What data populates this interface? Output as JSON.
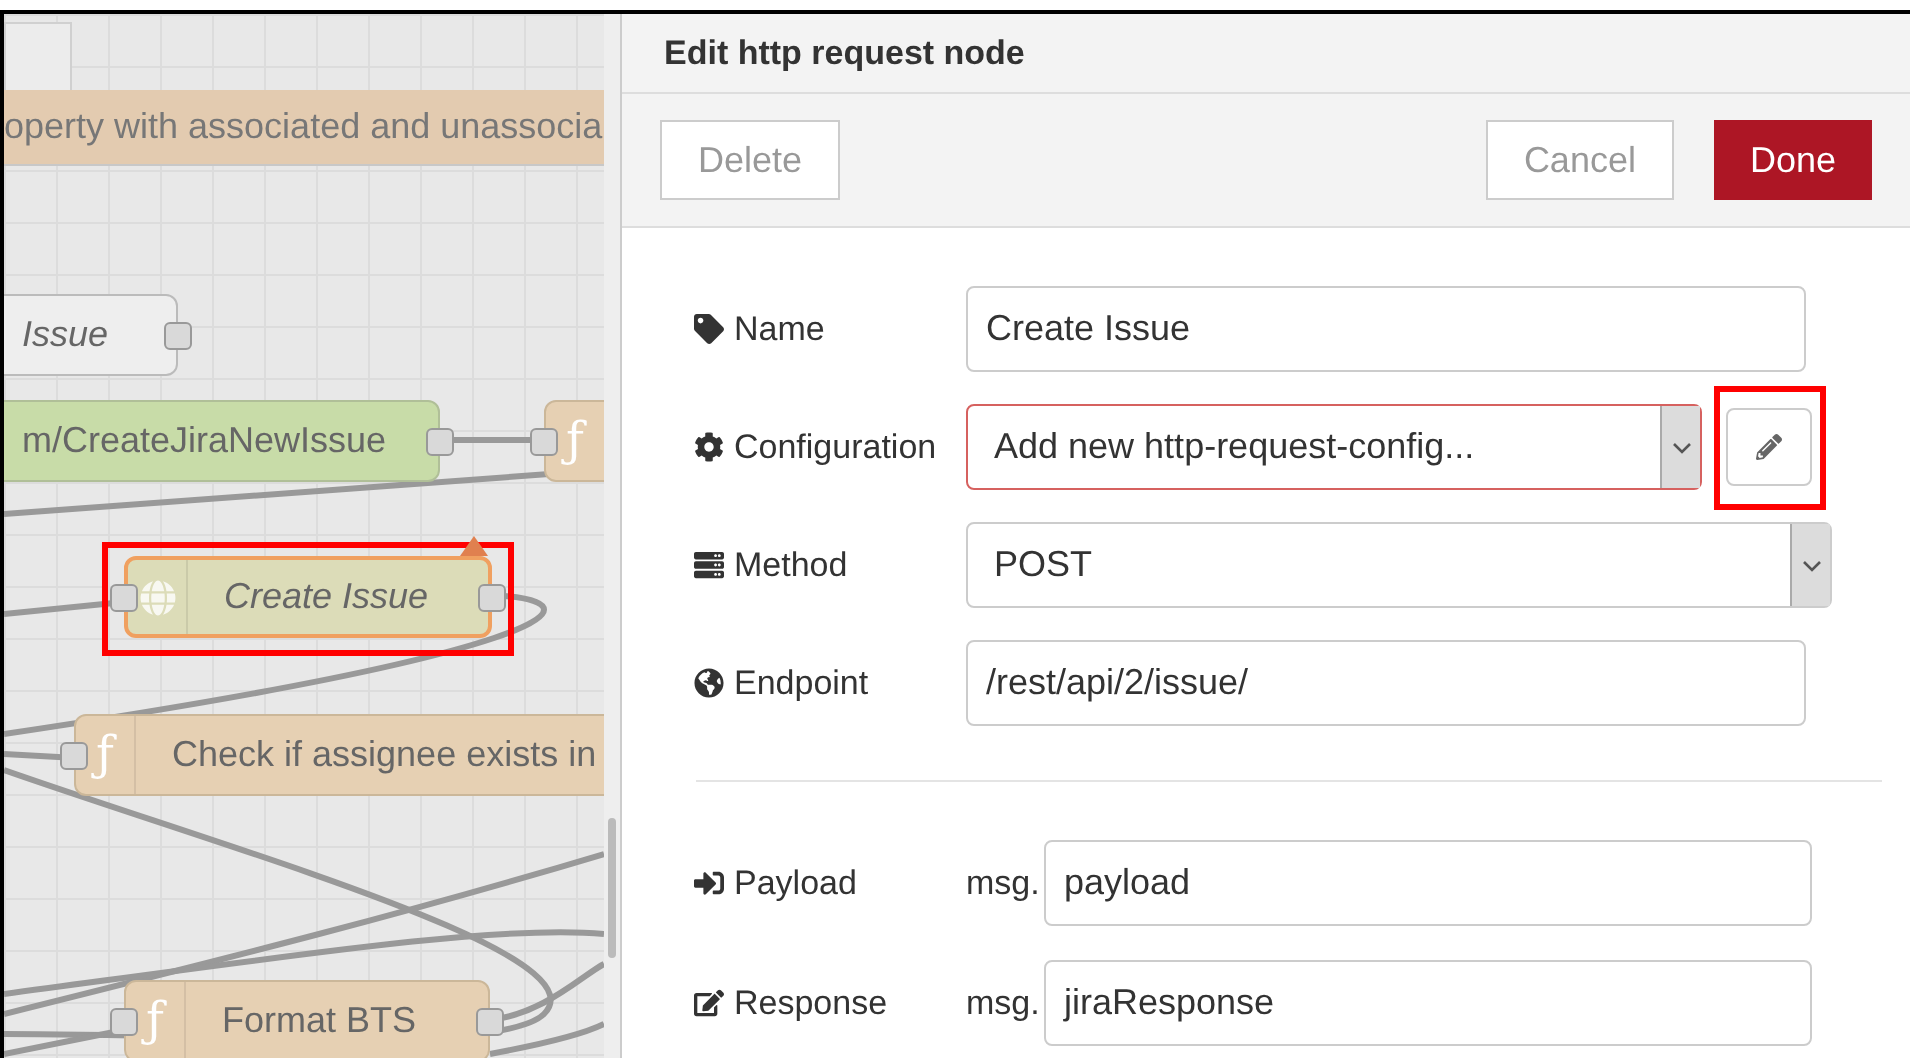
{
  "canvas": {
    "comment": "operty with associated and unassocia",
    "nodes": [
      {
        "kind": "link",
        "label": "Issue",
        "highlighted": false,
        "changed": false
      },
      {
        "kind": "http-in",
        "label": "m/CreateJiraNewIssue",
        "highlighted": false,
        "changed": false
      },
      {
        "kind": "function-stub",
        "glyph": "ƒ",
        "highlighted": false,
        "changed": false
      },
      {
        "kind": "http",
        "label": "Create Issue",
        "highlighted": true,
        "changed": true
      },
      {
        "kind": "function",
        "glyph": "ƒ",
        "label": "Check if assignee exists in",
        "highlighted": false,
        "changed": false
      },
      {
        "kind": "function",
        "glyph": "ƒ",
        "label": "Format BTS",
        "highlighted": false,
        "changed": false
      }
    ]
  },
  "editor": {
    "title": "Edit http request node",
    "buttons": [
      {
        "label": "Delete",
        "kind": "default"
      },
      {
        "label": "Cancel",
        "kind": "default"
      },
      {
        "label": "Done",
        "kind": "primary"
      }
    ],
    "fields": [
      {
        "kind": "text",
        "label": "Name",
        "value": "Create Issue"
      },
      {
        "kind": "select-edit",
        "label": "Configuration",
        "value": "Add new http-request-config...",
        "invalid": true,
        "edit_highlighted": true
      },
      {
        "kind": "select",
        "label": "Method",
        "value": "POST"
      },
      {
        "kind": "text",
        "label": "Endpoint",
        "value": "/rest/api/2/issue/"
      }
    ],
    "msg_fields": [
      {
        "label": "Payload",
        "prefix": "msg.",
        "value": "payload"
      },
      {
        "label": "Response",
        "prefix": "msg.",
        "value": "jiraResponse"
      }
    ]
  }
}
